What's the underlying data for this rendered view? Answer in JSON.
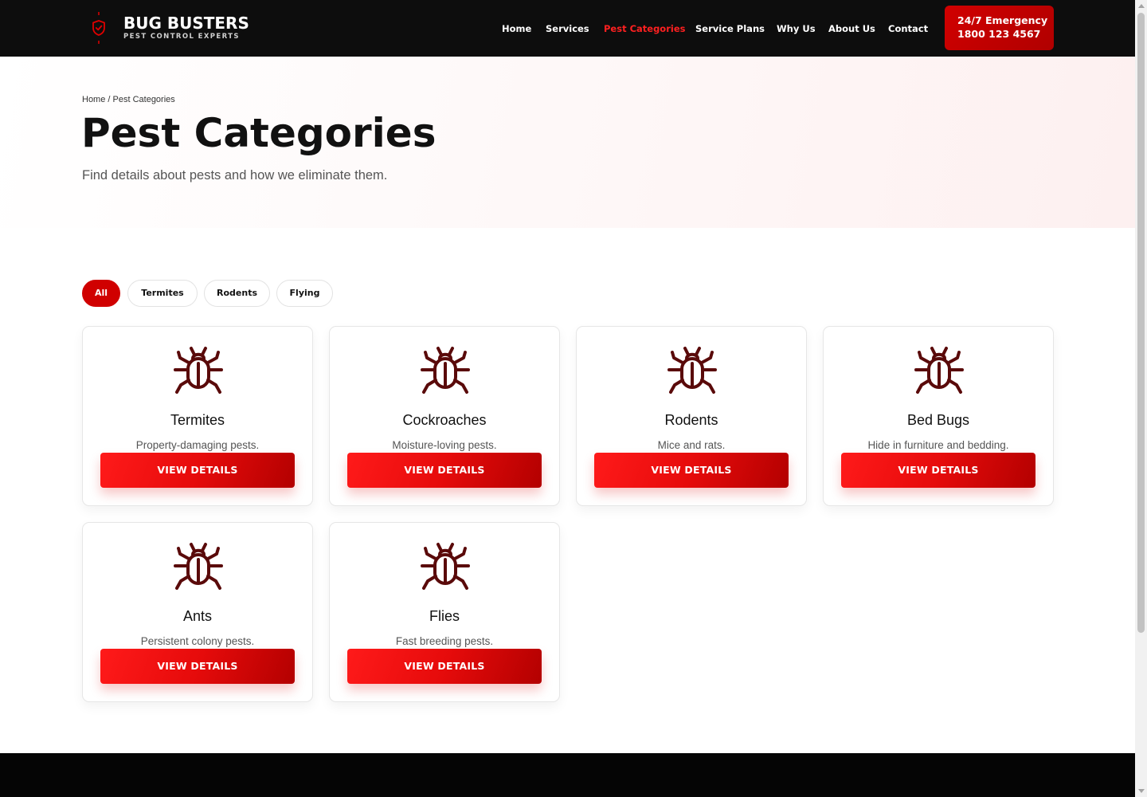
{
  "brand": {
    "name": "BUG BUSTERS",
    "tagline": "PEST CONTROL EXPERTS",
    "logo_icon": "shield-check-icon"
  },
  "nav": {
    "items": [
      {
        "label": "Home",
        "active": false
      },
      {
        "label": "Services",
        "active": false
      },
      {
        "label": "Pest Categories",
        "active": true
      },
      {
        "label": "Service Plans",
        "active": false
      },
      {
        "label": "Why Us",
        "active": false
      },
      {
        "label": "About Us",
        "active": false
      },
      {
        "label": "Contact",
        "active": false
      }
    ],
    "emergency_line1": "24/7 Emergency",
    "emergency_line2": "1800 123 4567"
  },
  "breadcrumb": {
    "home": "Home",
    "separator": " / ",
    "current": "Pest Categories"
  },
  "hero": {
    "title": "Pest Categories",
    "subtitle": "Find details about pests and how we eliminate them."
  },
  "filters": [
    {
      "label": "All",
      "active": true
    },
    {
      "label": "Termites",
      "active": false
    },
    {
      "label": "Rodents",
      "active": false
    },
    {
      "label": "Flying",
      "active": false
    }
  ],
  "cards": [
    {
      "title": "Termites",
      "description": "Property-damaging pests.",
      "button": "VIEW DETAILS",
      "icon": "bug-icon"
    },
    {
      "title": "Cockroaches",
      "description": "Moisture-loving pests.",
      "button": "VIEW DETAILS",
      "icon": "bug-icon"
    },
    {
      "title": "Rodents",
      "description": "Mice and rats.",
      "button": "VIEW DETAILS",
      "icon": "bug-icon"
    },
    {
      "title": "Bed Bugs",
      "description": "Hide in furniture and bedding.",
      "button": "VIEW DETAILS",
      "icon": "bug-icon"
    },
    {
      "title": "Ants",
      "description": "Persistent colony pests.",
      "button": "VIEW DETAILS",
      "icon": "bug-icon"
    },
    {
      "title": "Flies",
      "description": "Fast breeding pests.",
      "button": "VIEW DETAILS",
      "icon": "bug-icon"
    }
  ],
  "colors": {
    "accent": "#d00000",
    "header_bg": "#0d0d0d",
    "icon": "#5a0a0a",
    "active_nav": "#ff2020"
  }
}
